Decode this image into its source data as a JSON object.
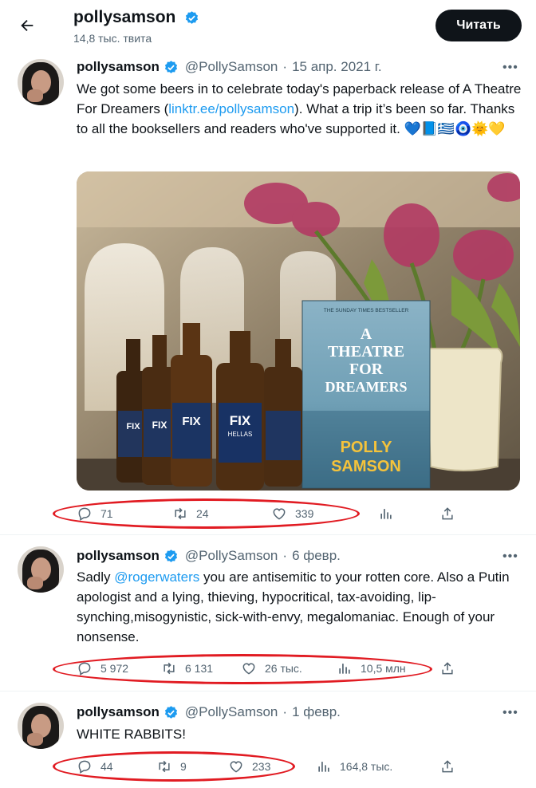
{
  "header": {
    "name": "pollysamson",
    "tweet_count": "14,8 тыс. твита",
    "follow_label": "Читать"
  },
  "tweets": [
    {
      "name": "pollysamson",
      "handle": "@PollySamson",
      "dot": "·",
      "date": "15 апр. 2021 г.",
      "text_before": "We got some beers in to celebrate today's paperback release of A Theatre For Dreamers (",
      "link": "linktr.ee/pollysamson",
      "text_after": "). What a trip it’s been so far. Thanks to all the booksellers and readers who've supported it. 💙📘🇬🇷🧿🌞💛",
      "image_alt": "Beer bottles labelled FIX HELLAS next to the book A Theatre For Dreamers by Polly Samson and pink tulips",
      "book": {
        "badge": "THE SUNDAY TIMES BESTSELLER",
        "title_lines": [
          "A",
          "THEATRE",
          "FOR",
          "DREAMERS"
        ],
        "author_lines": [
          "POLLY",
          "SAMSON"
        ]
      },
      "beer_label": "FIX",
      "beer_sub": "HELLAS",
      "replies": "71",
      "retweets": "24",
      "likes": "339",
      "views": ""
    },
    {
      "name": "pollysamson",
      "handle": "@PollySamson",
      "dot": "·",
      "date": "6 февр.",
      "text_before": "Sadly ",
      "link": "@rogerwaters",
      "text_after": " you are antisemitic to your rotten core. Also a Putin apologist and a lying, thieving, hypocritical, tax-avoiding, lip-synching,misogynistic, sick-with-envy, megalomaniac. Enough of your nonsense.",
      "replies": "5 972",
      "retweets": "6 131",
      "likes": "26 тыс.",
      "views": "10,5 млн"
    },
    {
      "name": "pollysamson",
      "handle": "@PollySamson",
      "dot": "·",
      "date": "1 февр.",
      "text": "WHITE RABBITS!",
      "replies": "44",
      "retweets": "9",
      "likes": "233",
      "views": "164,8 тыс."
    }
  ],
  "colors": {
    "accent": "#1d9bf0",
    "text": "#0f1419",
    "muted": "#536471",
    "verified": "#1d9bf0",
    "highlight_oval": "#e11b22"
  },
  "icons": [
    "back-arrow-icon",
    "verified-badge-icon",
    "more-icon",
    "reply-icon",
    "retweet-icon",
    "like-icon",
    "views-icon",
    "share-icon"
  ]
}
